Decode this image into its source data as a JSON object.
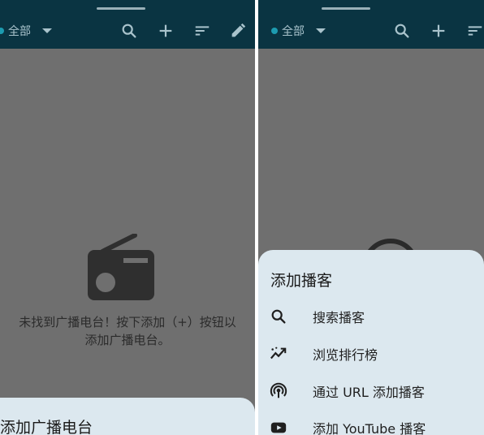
{
  "left_screen": {
    "filter_label": "全部",
    "empty_message_line1": "未找到广播电台！按下添加（+）按钮以",
    "empty_message_line2": "添加广播电台。",
    "sheet_title": "添加广播电台",
    "toolbar_icons": [
      "search-icon",
      "add-icon",
      "sort-icon",
      "edit-icon"
    ]
  },
  "right_screen": {
    "filter_label": "全部",
    "sheet_title": "添加播客",
    "toolbar_icons": [
      "search-icon",
      "add-icon",
      "sort-icon"
    ],
    "menu": [
      {
        "icon": "search-icon",
        "label": "搜索播客"
      },
      {
        "icon": "trending-icon",
        "label": "浏览排行榜"
      },
      {
        "icon": "podcast-feed-icon",
        "label": "通过 URL 添加播客"
      },
      {
        "icon": "youtube-icon",
        "label": "添加 YouTube 播客"
      }
    ]
  },
  "colors": {
    "topbar": "#0a3442",
    "scrim": "#6f6f6f",
    "sheet": "#dce8ef",
    "accent_dot": "#1d9bb0"
  }
}
